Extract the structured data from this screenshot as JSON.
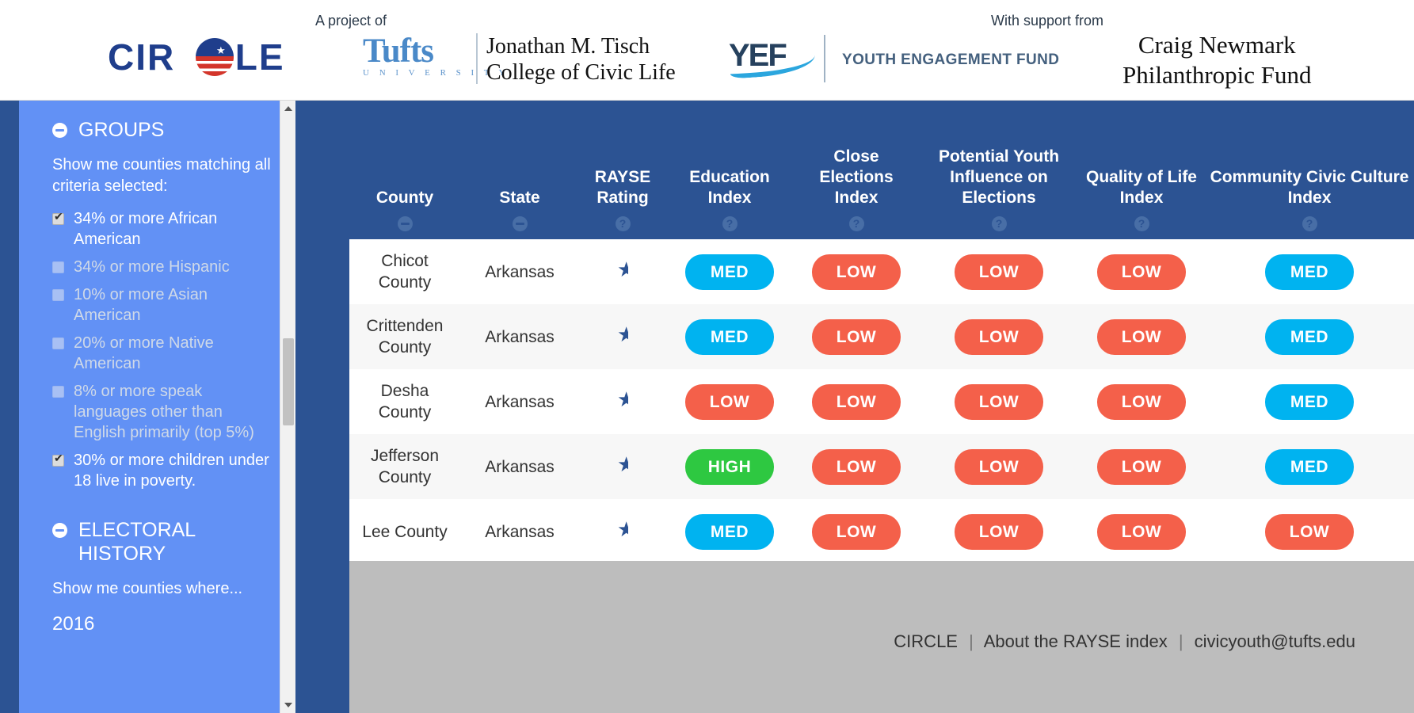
{
  "header": {
    "project_caption": "A project of",
    "support_caption": "With support from",
    "circle_logo": {
      "text_left": "CIR",
      "text_right": "LE",
      "icon": "flag-circle-icon"
    },
    "tufts": {
      "wordmark": "Tufts",
      "subtitle": "U N I V E R S I T Y",
      "school_line1": "Jonathan M. Tisch",
      "school_line2": "College of Civic Life"
    },
    "yef": {
      "wordmark": "YEF",
      "name": "YOUTH ENGAGEMENT FUND"
    },
    "newmark": {
      "line1": "Craig Newmark",
      "line2": "Philanthropic Fund"
    }
  },
  "sidebar": {
    "sections": [
      {
        "title": "GROUPS",
        "prompt": "Show me counties matching all criteria selected:",
        "criteria": [
          {
            "label": "34% or more African American",
            "checked": true,
            "enabled": true
          },
          {
            "label": "34% or more Hispanic",
            "checked": false,
            "enabled": false
          },
          {
            "label": "10% or more Asian American",
            "checked": false,
            "enabled": false
          },
          {
            "label": "20% or more Native American",
            "checked": false,
            "enabled": false
          },
          {
            "label": "8% or more speak languages other than English primarily (top 5%)",
            "checked": false,
            "enabled": false
          },
          {
            "label": "30% or more children under 18 live in poverty.",
            "checked": true,
            "enabled": true
          }
        ]
      },
      {
        "title": "ELECTORAL HISTORY",
        "prompt": "Show me counties where...",
        "year": "2016",
        "criteria": []
      }
    ]
  },
  "table": {
    "columns": [
      {
        "label": "County",
        "icon": "minus-circle-icon",
        "align": "left"
      },
      {
        "label": "State",
        "icon": "minus-circle-icon",
        "align": "left"
      },
      {
        "label": "RAYSE Rating",
        "icon": "help-circle-icon",
        "align": "center"
      },
      {
        "label": "Education Index",
        "icon": "help-circle-icon",
        "align": "center"
      },
      {
        "label": "Close Elections Index",
        "icon": "help-circle-icon",
        "align": "center"
      },
      {
        "label": "Potential Youth Influence on Elections",
        "icon": "help-circle-icon",
        "align": "center"
      },
      {
        "label": "Quality of Life Index",
        "icon": "help-circle-icon",
        "align": "center"
      },
      {
        "label": "Community Civic Culture Index",
        "icon": "help-circle-icon",
        "align": "center"
      }
    ],
    "rows": [
      {
        "county": "Chicot County",
        "state": "Arkansas",
        "rayse": "half-star",
        "education": "MED",
        "close_elections": "LOW",
        "youth_influence": "LOW",
        "quality_of_life": "LOW",
        "civic_culture": "MED"
      },
      {
        "county": "Crittenden County",
        "state": "Arkansas",
        "rayse": "half-star",
        "education": "MED",
        "close_elections": "LOW",
        "youth_influence": "LOW",
        "quality_of_life": "LOW",
        "civic_culture": "MED"
      },
      {
        "county": "Desha County",
        "state": "Arkansas",
        "rayse": "half-star",
        "education": "LOW",
        "close_elections": "LOW",
        "youth_influence": "LOW",
        "quality_of_life": "LOW",
        "civic_culture": "MED"
      },
      {
        "county": "Jefferson County",
        "state": "Arkansas",
        "rayse": "half-star",
        "education": "HIGH",
        "close_elections": "LOW",
        "youth_influence": "LOW",
        "quality_of_life": "LOW",
        "civic_culture": "MED"
      },
      {
        "county": "Lee County",
        "state": "Arkansas",
        "rayse": "half-star",
        "education": "MED",
        "close_elections": "LOW",
        "youth_influence": "LOW",
        "quality_of_life": "LOW",
        "civic_culture": "LOW"
      }
    ]
  },
  "footer": {
    "links": [
      "CIRCLE",
      "About the RAYSE index",
      "civicyouth@tufts.edu"
    ],
    "separator": "|"
  },
  "colors": {
    "low": "#f4604a",
    "med": "#00b3f0",
    "high": "#2ec841",
    "header_blue": "#2c5393",
    "sidebar_blue": "#6291f5",
    "footer_grey": "#bdbdbd"
  }
}
